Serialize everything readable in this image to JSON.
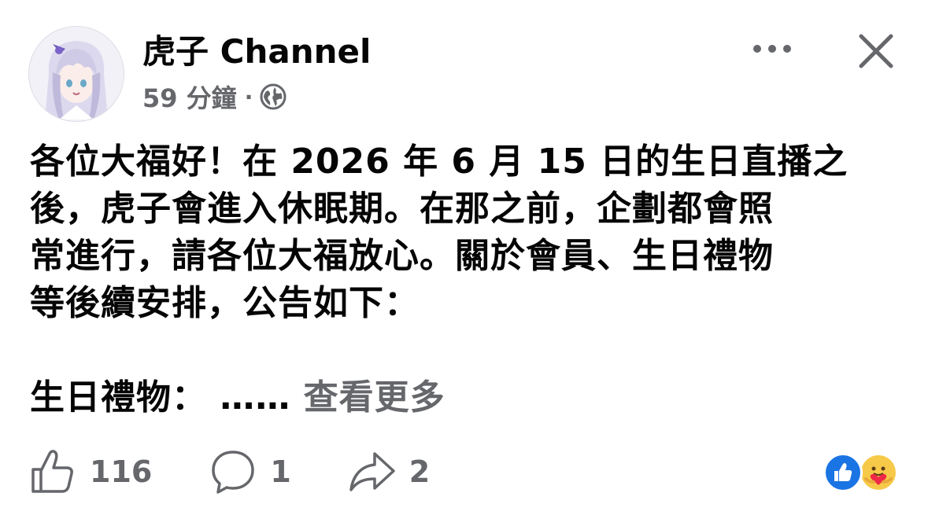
{
  "post": {
    "page_name": "虎子 Channel",
    "time_ago": "59 分鐘",
    "separator": "·",
    "privacy_icon": "globe-icon",
    "avatar_icon": "anime-girl-avatar",
    "more_icon": "more-dots-icon",
    "close_icon": "close-icon",
    "body_lines": [
      "各位大福好！在 2026 年 6 月 15 日的生日直播之",
      "後，虎子會進入休眠期。在那之前，企劃都會照",
      "常進行，請各位大福放心。關於會員、生日禮物",
      "等後續安排，公告如下："
    ],
    "last_line_prefix": "生日禮物： ……",
    "see_more": "查看更多"
  },
  "actions": {
    "like_icon": "thumbs-up-icon",
    "like_count": "116",
    "comment_icon": "comment-bubble-icon",
    "comment_count": "1",
    "share_icon": "share-arrow-icon",
    "share_count": "2"
  },
  "reactions": {
    "items": [
      "like-reaction",
      "care-reaction"
    ],
    "colors": {
      "like": "#1b74e4",
      "care": "#f7c948",
      "heart": "#f02849"
    }
  },
  "colors": {
    "text": "#050505",
    "secondary": "#65676b",
    "icon_gray": "#65676b"
  }
}
